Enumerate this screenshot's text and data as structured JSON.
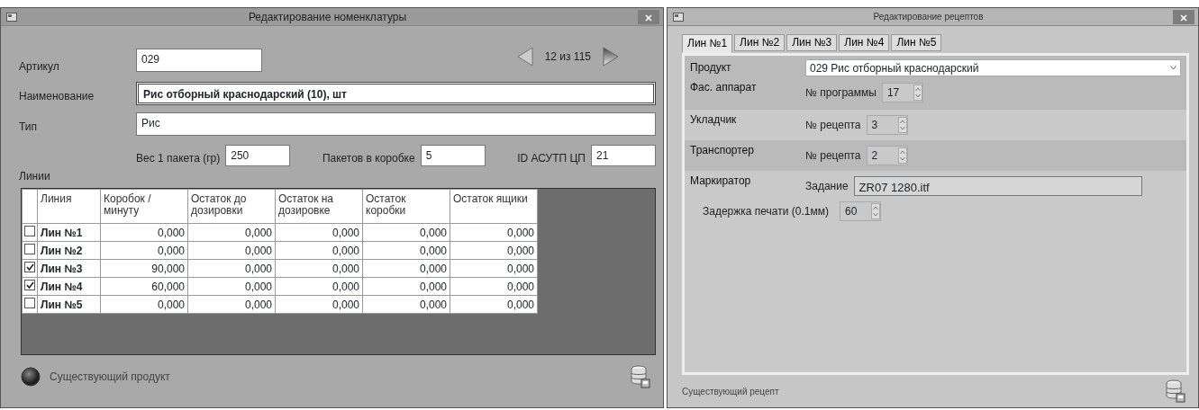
{
  "item_editor": {
    "title": "Редактирование номенклатуры",
    "counter": "12 из 115",
    "fields": [
      {
        "label": "Артикул",
        "value": "029",
        "kind": "short"
      },
      {
        "label": "Наименование",
        "value": "Рис отборный краснодарский (10), шт",
        "kind": "focused"
      },
      {
        "label": "Тип",
        "value": "Рис",
        "kind": "wide"
      }
    ],
    "params": [
      {
        "label": "Вес 1 пакета (гр)",
        "value": "250"
      },
      {
        "label": "Пакетов в коробке",
        "value": "5"
      },
      {
        "label": "ID АСУТП ЦП",
        "value": "21"
      }
    ],
    "lines_label": "Линии",
    "table": {
      "columns": [
        "Линия",
        "Коробок / минуту",
        "Остаток до дозировки",
        "Остаток на дозировке",
        "Остаток коробки",
        "Остаток ящики"
      ],
      "rows": [
        {
          "checked": false,
          "cells": [
            "Лин №1",
            "0,000",
            "0,000",
            "0,000",
            "0,000",
            "0,000"
          ]
        },
        {
          "checked": false,
          "cells": [
            "Лин №2",
            "0,000",
            "0,000",
            "0,000",
            "0,000",
            "0,000"
          ]
        },
        {
          "checked": true,
          "cells": [
            "Лин №3",
            "90,000",
            "0,000",
            "0,000",
            "0,000",
            "0,000"
          ]
        },
        {
          "checked": true,
          "cells": [
            "Лин №4",
            "60,000",
            "0,000",
            "0,000",
            "0,000",
            "0,000"
          ]
        },
        {
          "checked": false,
          "cells": [
            "Лин №5",
            "0,000",
            "0,000",
            "0,000",
            "0,000",
            "0,000"
          ]
        }
      ]
    },
    "status": "Существующий продукт"
  },
  "recipe_editor": {
    "title": "Редактирование рецептов",
    "tabs": [
      {
        "label": "Лин №1",
        "selected": true
      },
      {
        "label": "Лин №2",
        "selected": false
      },
      {
        "label": "Лин №3",
        "selected": false
      },
      {
        "label": "Лин №4",
        "selected": false
      },
      {
        "label": "Лин №5",
        "selected": false
      }
    ],
    "product": {
      "label": "Продукт",
      "value": "029 Рис отборный краснодарский"
    },
    "rows": [
      {
        "label": "Фас. аппарат",
        "field_label": "№ программы",
        "value": "17",
        "kind": "spin"
      },
      {
        "label": "Укладчик",
        "field_label": "№ рецепта",
        "value": "3",
        "kind": "spin"
      },
      {
        "label": "Транспортер",
        "field_label": "№ рецепта",
        "value": "2",
        "kind": "spin"
      },
      {
        "label": "Маркиратор",
        "field_label": "Задание",
        "value": "ZR07 1280.itf",
        "kind": "text"
      }
    ],
    "delay": {
      "label": "Задержка печати (0.1мм)",
      "value": "60"
    },
    "status": "Существующий рецепт"
  }
}
